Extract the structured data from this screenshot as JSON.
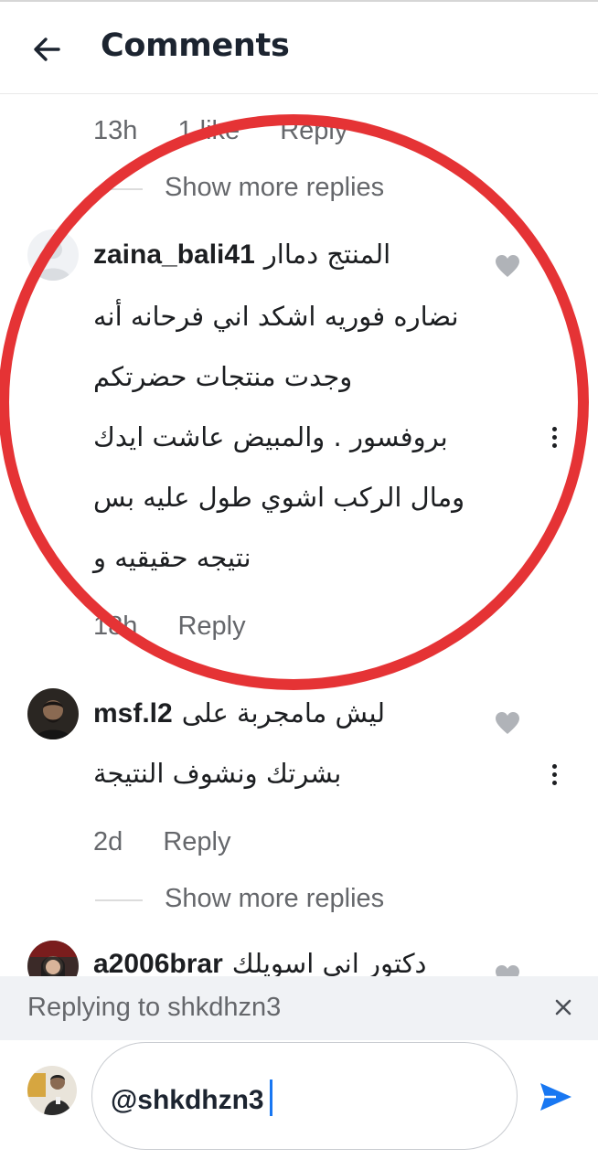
{
  "header": {
    "title": "Comments"
  },
  "comments": [
    {
      "time": "13h",
      "likes": "1 like",
      "reply": "Reply",
      "more_replies": "Show more replies"
    },
    {
      "username": "zaina_bali41",
      "lines": [
        "المنتج دماار",
        "نضاره فوريه اشكد اني فرحانه أنه",
        "وجدت منتجات حضرتكم",
        "بروفسور . والمبيض عاشت ايدك",
        "ومال الركب اشوي طول عليه بس",
        "نتيجه حقيقيه و"
      ],
      "time": "18h",
      "reply": "Reply"
    },
    {
      "username": "msf.l2",
      "lines": [
        "ليش مامجربة على",
        "بشرتك ونشوف النتيجة"
      ],
      "time": "2d",
      "reply": "Reply",
      "more_replies": "Show more replies"
    },
    {
      "username": "a2006brar",
      "lines": [
        "دكتور انى اسويلك"
      ]
    }
  ],
  "reply_bar": {
    "text": "Replying to shkdhzn3"
  },
  "composer": {
    "value": "@shkdhzn3"
  },
  "colors": {
    "accent": "#1877f2",
    "annotation": "#e53335",
    "muted": "#65676b"
  },
  "icons": [
    "back-arrow-icon",
    "heart-icon",
    "more-vertical-icon",
    "close-icon",
    "send-icon"
  ]
}
